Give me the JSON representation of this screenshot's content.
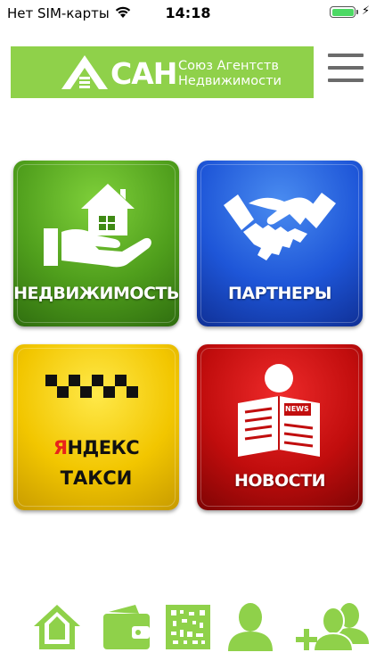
{
  "status_bar": {
    "carrier": "Нет SIM-карты",
    "time": "14:18",
    "wifi_icon": "wifi-icon",
    "battery_icon": "battery-icon",
    "charging_icon": "bolt-icon",
    "battery_level": 1.0
  },
  "header": {
    "logo_abbr": "САН",
    "logo_line1": "Союз Агентств",
    "logo_line2": "Недвижимости",
    "logo_color": "#8fd14a",
    "menu_icon": "hamburger-icon"
  },
  "tiles": [
    {
      "id": "real-estate",
      "label": "НЕДВИЖИМОСТЬ",
      "icon": "house-in-hand-icon",
      "color": "#4f9e1c"
    },
    {
      "id": "partners",
      "label": "ПАРТНЕРЫ",
      "icon": "handshake-icon",
      "color": "#1e56d8"
    },
    {
      "id": "taxi",
      "label_first_letter": "Я",
      "label_rest": "НДЕКС",
      "label_line2": "ТАКСИ",
      "icon": "taxi-checker-icon",
      "color": "#f2c600"
    },
    {
      "id": "news",
      "label": "НОВОСТИ",
      "icon": "newspaper-reader-icon",
      "color": "#c10d0d",
      "badge": "NEWS"
    }
  ],
  "tab_bar": {
    "color": "#8fd14a",
    "items": [
      {
        "id": "home",
        "icon": "home-icon"
      },
      {
        "id": "wallet",
        "icon": "wallet-icon"
      },
      {
        "id": "qr",
        "icon": "qr-code-icon"
      },
      {
        "id": "profile",
        "icon": "user-icon"
      },
      {
        "id": "add-contact",
        "icon": "add-users-icon"
      }
    ]
  }
}
